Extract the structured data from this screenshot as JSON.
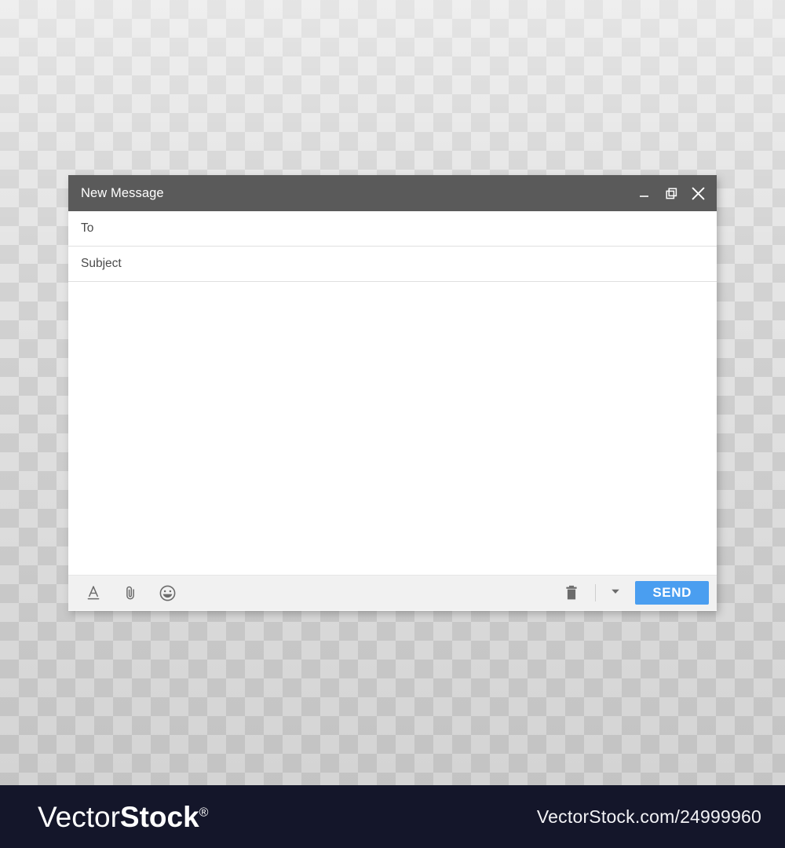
{
  "window": {
    "title": "New Message",
    "controls": [
      {
        "name": "minimize",
        "icon": "minimize-icon",
        "label": "_"
      },
      {
        "name": "restore",
        "icon": "restore-window-icon",
        "label": "❐"
      },
      {
        "name": "close",
        "icon": "close-icon",
        "label": "✕"
      }
    ],
    "fields": [
      {
        "name": "to",
        "label": "To",
        "value": "",
        "placeholder": "To"
      },
      {
        "name": "subject",
        "label": "Subject",
        "value": "",
        "placeholder": "Subject"
      }
    ],
    "body": {
      "value": "",
      "placeholder": ""
    },
    "toolbar": {
      "left_tools": [
        {
          "name": "formatting",
          "icon": "format-text-icon",
          "title": "Formatting options"
        },
        {
          "name": "attach",
          "icon": "paperclip-icon",
          "title": "Attach files"
        },
        {
          "name": "emoji",
          "icon": "emoji-smiley-icon",
          "title": "Insert emoji"
        }
      ],
      "right_tools": [
        {
          "name": "discard",
          "icon": "trash-icon",
          "title": "Discard draft"
        },
        {
          "name": "more",
          "icon": "chevron-down-icon",
          "title": "More send options"
        }
      ],
      "send_label": "SEND"
    }
  },
  "footer": {
    "logo_light": "Vector",
    "logo_bold": "Stock",
    "logo_registered": "®",
    "url": "VectorStock.com/24999960"
  },
  "colors": {
    "titlebar": "#5a5a5a",
    "send_blue": "#4a9ef0",
    "toolbar_bg": "#f1f1f1",
    "footer_bg": "#14162a",
    "icon_gray": "#6b6b6b",
    "field_text": "#4a4a4a"
  }
}
